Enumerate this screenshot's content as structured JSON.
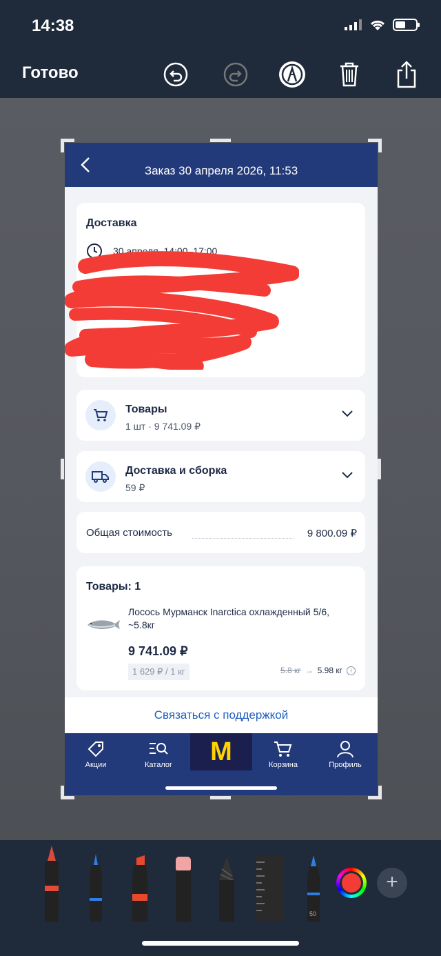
{
  "status_bar": {
    "time": "14:38"
  },
  "markup_header": {
    "done_label": "Готово"
  },
  "app": {
    "header_title": "Заказ 30 апреля 2026, 11:53",
    "delivery": {
      "title": "Доставка",
      "time": "30 апреля, 14:00–17:00"
    },
    "goods_summary": {
      "title": "Товары",
      "subtitle": "1 шт · 9 741.09 ₽"
    },
    "delivery_summary": {
      "title": "Доставка и сборка",
      "subtitle": "59 ₽"
    },
    "total": {
      "label": "Общая стоимость",
      "value": "9 800.09 ₽"
    },
    "items": {
      "title": "Товары: 1",
      "product_name": "Лосось Мурманск Inarctica охлажденный 5/6, ~5.8кг",
      "price": "9 741.09 ₽",
      "unit_price": "1 629 ₽ / 1 кг",
      "weight_old": "5.8 кг",
      "weight_new": "5.98 кг"
    },
    "support_label": "Связаться с поддержкой",
    "tabs": [
      "Акции",
      "Каталог",
      "Корзина",
      "Профиль"
    ],
    "logo_letter": "M"
  },
  "markup_tools": {
    "marker_size": "50"
  },
  "colors": {
    "header": "#233a7a",
    "accent": "#1e5fbf",
    "logo": "#ffd200",
    "scribble": "#f43c36"
  }
}
